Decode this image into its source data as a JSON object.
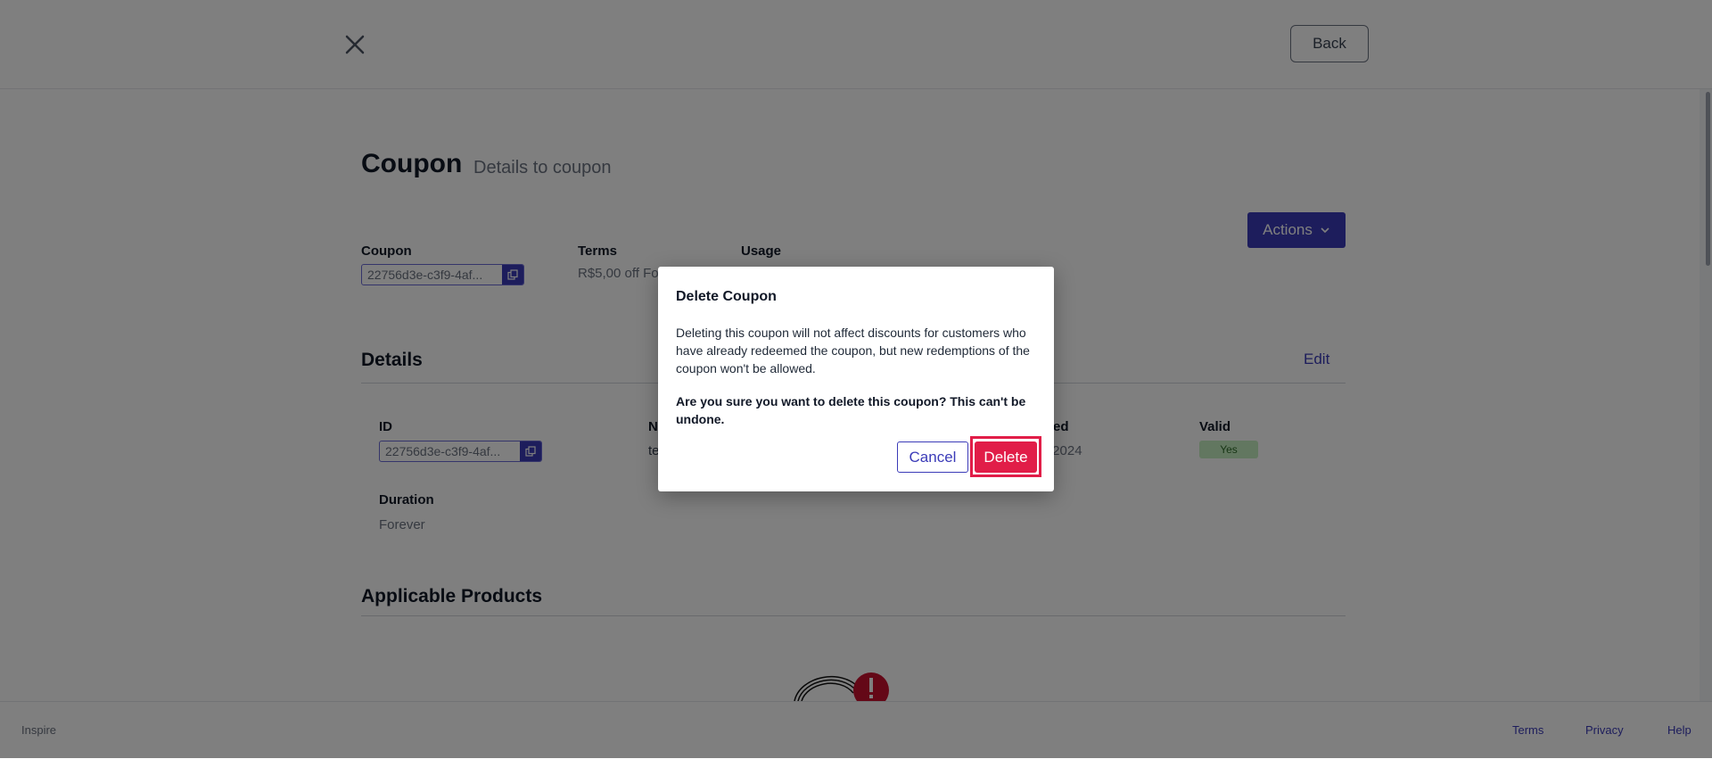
{
  "header": {
    "back_label": "Back"
  },
  "page": {
    "title": "Coupon",
    "subtitle": "Details to coupon",
    "actions_label": "Actions"
  },
  "summary": {
    "coupon_label": "Coupon",
    "coupon_id": "22756d3e-c3f9-4af...",
    "terms_label": "Terms",
    "terms_value": "R$5,00 off Fo",
    "usage_label": "Usage"
  },
  "details": {
    "title": "Details",
    "edit_label": "Edit",
    "id_label": "ID",
    "id_value": "22756d3e-c3f9-4af...",
    "name_label_partial": "N",
    "name_value_partial": "te",
    "created_label_partial": "ted",
    "created_value_partial": "/2024",
    "valid_label": "Valid",
    "valid_value": "Yes",
    "duration_label": "Duration",
    "duration_value": "Forever"
  },
  "products": {
    "title": "Applicable Products"
  },
  "footer": {
    "brand": "Inspire",
    "links": [
      "Terms",
      "Privacy",
      "Help"
    ]
  },
  "modal": {
    "title": "Delete Coupon",
    "body": "Deleting this coupon will not affect discounts for customers who have already redeemed the coupon, but new redemptions of the coupon won't be allowed.",
    "warning": "Are you sure you want to delete this coupon? This can't be undone.",
    "cancel_label": "Cancel",
    "delete_label": "Delete"
  },
  "colors": {
    "accent": "#3b3bb8",
    "danger": "#e11d48",
    "valid_badge": "#c5efc0"
  },
  "icons": [
    "close-icon",
    "copy-icon",
    "chevron-down-icon",
    "alert-icon"
  ]
}
